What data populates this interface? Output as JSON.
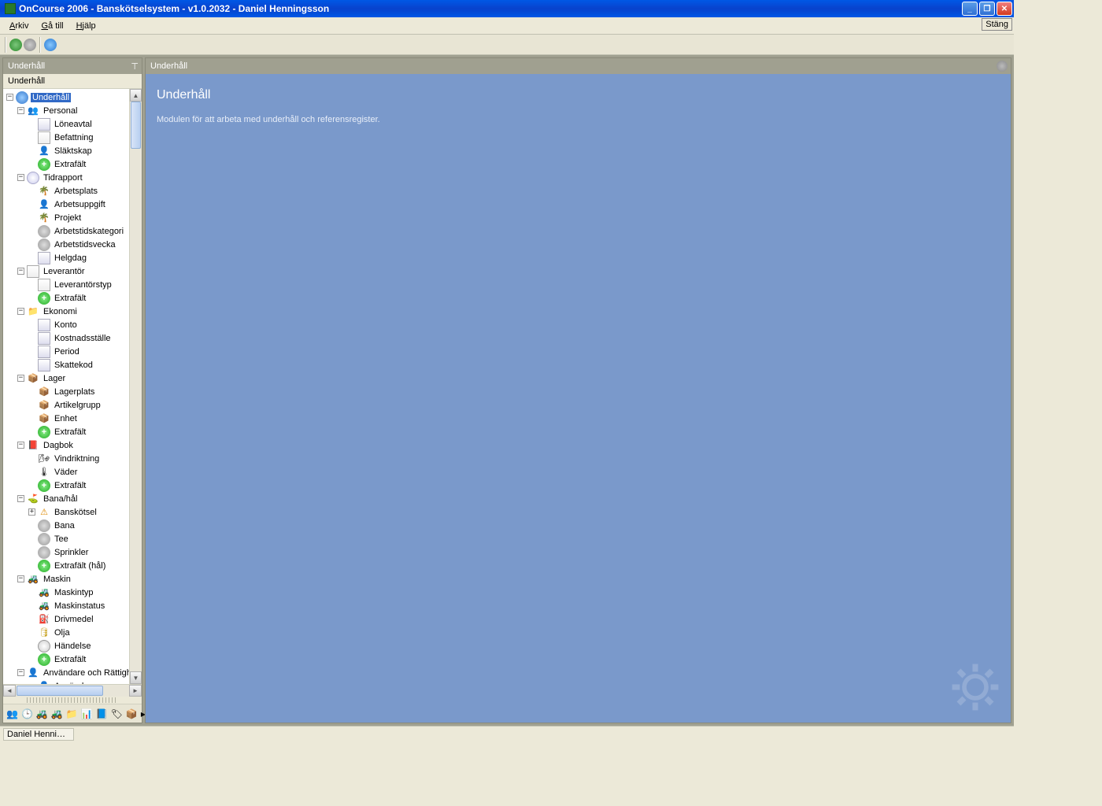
{
  "title": "OnCourse 2006 - Banskötselsystem - v1.0.2032 - Daniel Henningsson",
  "menu": {
    "arkiv": "Arkiv",
    "gatill": "Gå till",
    "hjalp": "Hjälp",
    "stang": "Stäng"
  },
  "sidebar": {
    "title": "Underhåll",
    "root_label": "Underhåll",
    "tree_root": "Underhåll",
    "nodes": {
      "personal": "Personal",
      "loneavtal": "Löneavtal",
      "befattning": "Befattning",
      "slaktskap": "Släktskap",
      "extrafalt1": "Extrafält",
      "tidrapport": "Tidrapport",
      "arbetsplats": "Arbetsplats",
      "arbetsuppgift": "Arbetsuppgift",
      "projekt": "Projekt",
      "arbetstidskategori": "Arbetstidskategori",
      "arbetstidsvecka": "Arbetstidsvecka",
      "helgdag": "Helgdag",
      "leverantor": "Leverantör",
      "leverantorstyp": "Leverantörstyp",
      "extrafalt2": "Extrafält",
      "ekonomi": "Ekonomi",
      "konto": "Konto",
      "kostnadsstalle": "Kostnadsställe",
      "period": "Period",
      "skattekod": "Skattekod",
      "lager": "Lager",
      "lagerplats": "Lagerplats",
      "artikelgrupp": "Artikelgrupp",
      "enhet": "Enhet",
      "extrafalt3": "Extrafält",
      "dagbok": "Dagbok",
      "vindriktning": "Vindriktning",
      "vader": "Väder",
      "extrafalt4": "Extrafält",
      "banahal": "Bana/hål",
      "banskotsel": "Banskötsel",
      "bana": "Bana",
      "tee": "Tee",
      "sprinkler": "Sprinkler",
      "extrafalt_hal": "Extrafält (hål)",
      "maskin": "Maskin",
      "maskintyp": "Maskintyp",
      "maskinstatus": "Maskinstatus",
      "drivmedel": "Drivmedel",
      "olja": "Olja",
      "handelse": "Händelse",
      "extrafalt5": "Extrafält",
      "anvandare": "Användare och Rättighe",
      "anvandare_sub": "Användare"
    }
  },
  "content": {
    "panel_title": "Underhåll",
    "heading": "Underhåll",
    "desc": "Modulen för att arbeta med underhåll och referensregister."
  },
  "status": {
    "user": "Daniel Henningss..."
  }
}
